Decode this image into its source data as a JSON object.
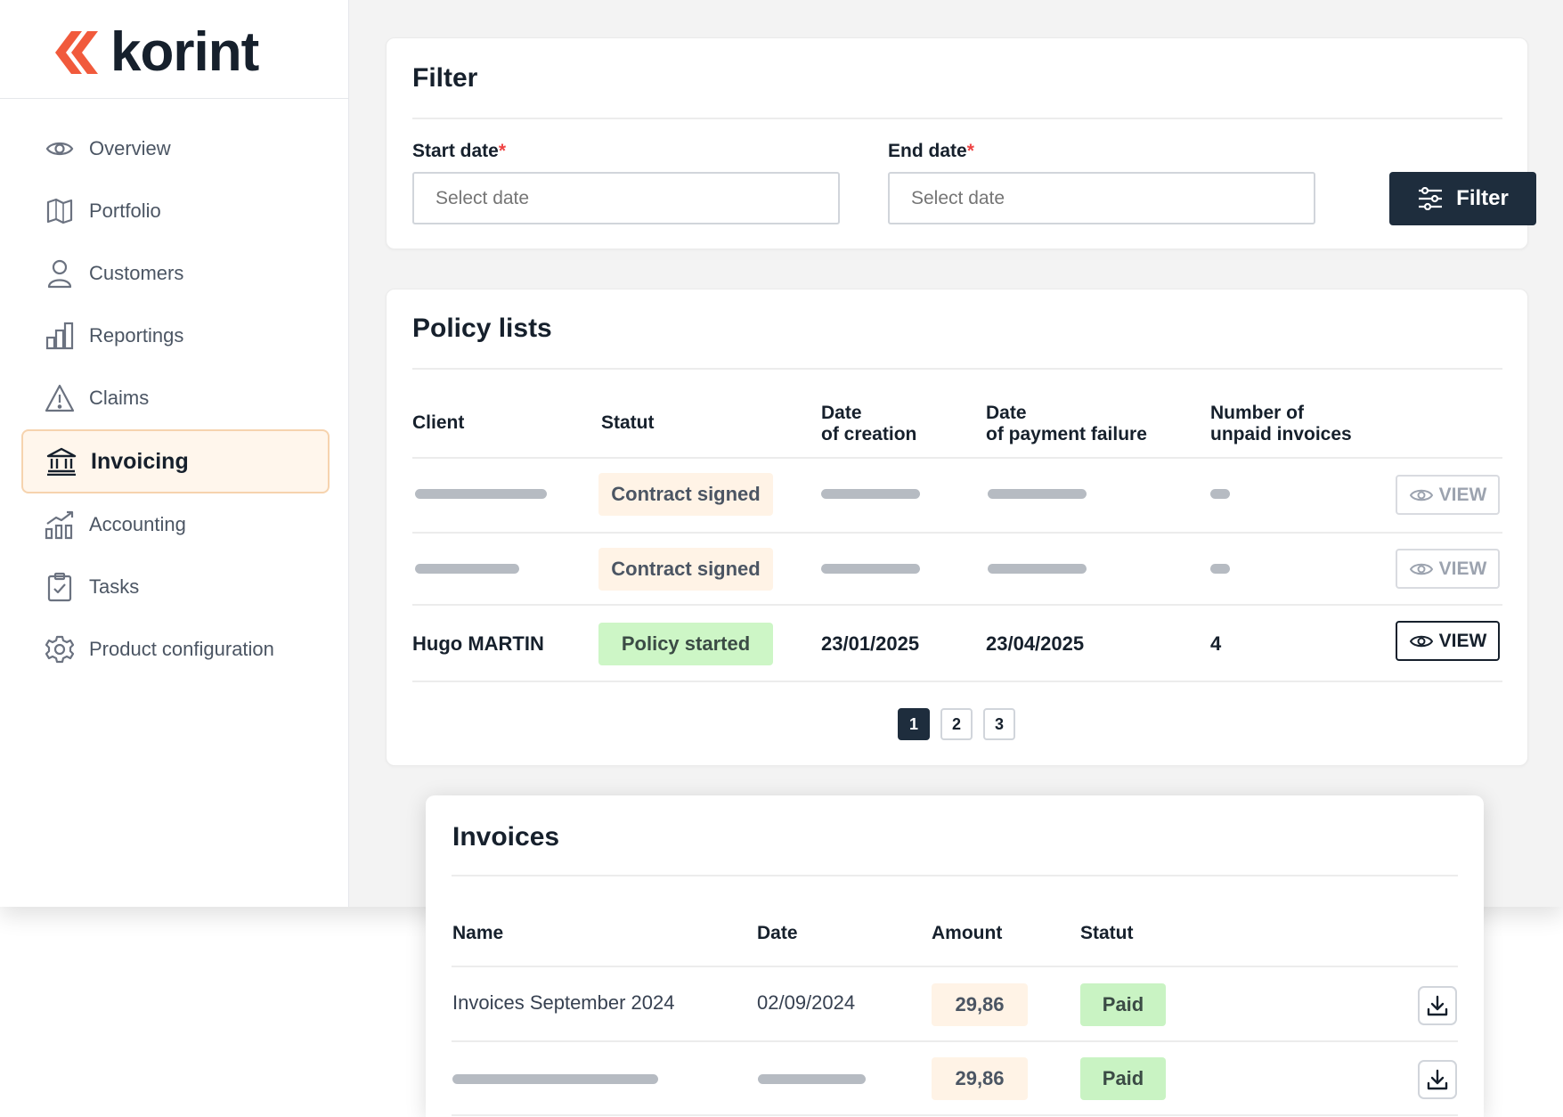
{
  "brand": {
    "name": "korint",
    "accent": "#f15a3c"
  },
  "sidebar": {
    "items": [
      {
        "label": "Overview",
        "icon": "eye-icon"
      },
      {
        "label": "Portfolio",
        "icon": "book-icon"
      },
      {
        "label": "Customers",
        "icon": "user-icon"
      },
      {
        "label": "Reportings",
        "icon": "bar-chart-icon"
      },
      {
        "label": "Claims",
        "icon": "warning-icon"
      },
      {
        "label": "Invoicing",
        "icon": "bank-icon",
        "active": true
      },
      {
        "label": "Accounting",
        "icon": "chart-growth-icon"
      },
      {
        "label": "Tasks",
        "icon": "clipboard-check-icon"
      },
      {
        "label": "Product configuration",
        "icon": "gear-icon"
      }
    ]
  },
  "filter": {
    "title": "Filter",
    "start_label": "Start date",
    "end_label": "End date",
    "required_mark": "*",
    "start_placeholder": "Select date",
    "end_placeholder": "Select date",
    "button_label": "Filter"
  },
  "policies": {
    "title": "Policy lists",
    "headers": {
      "client": "Client",
      "statut": "Statut",
      "creation_1": "Date",
      "creation_2": "of creation",
      "failure_1": "Date",
      "failure_2": "of payment failure",
      "unpaid_1": "Number of",
      "unpaid_2": "unpaid invoices"
    },
    "rows": [
      {
        "status": "Contract signed",
        "view": "VIEW"
      },
      {
        "status": "Contract signed",
        "view": "VIEW"
      },
      {
        "client": "Hugo MARTIN",
        "status": "Policy started",
        "created": "23/01/2025",
        "failure": "23/04/2025",
        "unpaid": "4",
        "view": "VIEW"
      }
    ],
    "pages": [
      "1",
      "2",
      "3"
    ],
    "current_page": "1"
  },
  "invoices": {
    "title": "Invoices",
    "headers": {
      "name": "Name",
      "date": "Date",
      "amount": "Amount",
      "statut": "Statut"
    },
    "rows": [
      {
        "name": "Invoices September 2024",
        "date": "02/09/2024",
        "amount": "29,86",
        "status": "Paid"
      },
      {
        "amount": "29,86",
        "status": "Paid"
      }
    ]
  }
}
